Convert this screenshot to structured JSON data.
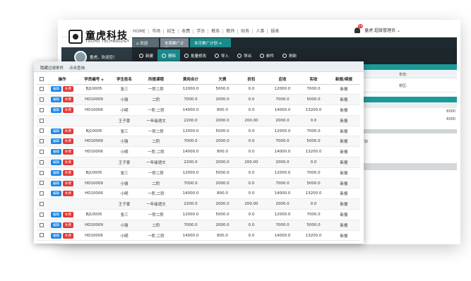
{
  "logo": {
    "cn": "童虎科技",
    "en": "TOOHU TECHNOLOGY"
  },
  "topnav": [
    "HOME",
    "市场",
    "招生",
    "收费",
    "学员",
    "教务",
    "教师",
    "财务",
    "人事",
    "报表"
  ],
  "user": {
    "badge": "10",
    "name": "童虎 超级管理员 ⌄"
  },
  "tabs": [
    "⌂ 欢迎",
    "本周推广计划 ×",
    "本月推广计划 ×"
  ],
  "toolbar": [
    "新建",
    "删除",
    "批量修改",
    "导入",
    "导出",
    "邮件",
    "刷新"
  ],
  "sidebar": {
    "welcome": "童虎，欢迎您！"
  },
  "right_panel": {
    "lbl1": "年份:",
    "lbl2": "校区:",
    "v1": "6000",
    "v2": "6000",
    "lbl3": "折扣"
  },
  "filter": {
    "hide": "隐藏过滤条件",
    "query": "点击查询"
  },
  "table": {
    "headers": [
      "操作",
      "学员编号",
      "学生姓名",
      "所报课程",
      "费用合计",
      "欠费",
      "折扣",
      "应收",
      "实收",
      "新报/续报"
    ],
    "edit_label": "编辑",
    "add_label": "补费",
    "rows": [
      {
        "has_ops": true,
        "id": "BJ10005",
        "name": "张三",
        "course": "一阶二阶",
        "total": "12000.0",
        "owe": "5000.0",
        "disc": "0.0",
        "due": "12000.0",
        "paid": "7000.0",
        "type": "新报"
      },
      {
        "has_ops": true,
        "id": "HD10009",
        "name": "小强",
        "course": "二阶",
        "total": "7000.0",
        "owe": "2000.0",
        "disc": "0.0",
        "due": "7000.0",
        "paid": "5000.0",
        "type": "新报"
      },
      {
        "has_ops": true,
        "id": "HD10006",
        "name": "小明",
        "course": "一阶,二阶",
        "total": "14000.0",
        "owe": "800.0",
        "disc": "0.0",
        "due": "14000.0",
        "paid": "13200.0",
        "type": "新报"
      },
      {
        "has_ops": false,
        "id": "",
        "name": "王子豪",
        "course": "一年级语文",
        "total": "2200.0",
        "owe": "2000.0",
        "disc": "200.00",
        "due": "2000.0",
        "paid": "0.0",
        "type": "新报"
      },
      {
        "has_ops": true,
        "id": "BJ10005",
        "name": "张三",
        "course": "一阶二阶",
        "total": "12000.0",
        "owe": "5000.0",
        "disc": "0.0",
        "due": "12000.0",
        "paid": "7000.0",
        "type": "新报"
      },
      {
        "has_ops": true,
        "id": "HD10009",
        "name": "小强",
        "course": "二阶",
        "total": "7000.0",
        "owe": "2000.0",
        "disc": "0.0",
        "due": "7000.0",
        "paid": "5000.0",
        "type": "新报"
      },
      {
        "has_ops": true,
        "id": "HD10006",
        "name": "小明",
        "course": "一阶,二阶",
        "total": "14000.0",
        "owe": "800.0",
        "disc": "0.0",
        "due": "14000.0",
        "paid": "13200.0",
        "type": "新报"
      },
      {
        "has_ops": true,
        "id": "",
        "name": "王子豪",
        "course": "一年级语文",
        "total": "2200.0",
        "owe": "2000.0",
        "disc": "200.00",
        "due": "2000.0",
        "paid": "0.0",
        "type": "新报"
      },
      {
        "has_ops": true,
        "id": "BJ10005",
        "name": "张三",
        "course": "一阶二阶",
        "total": "12000.0",
        "owe": "5000.0",
        "disc": "0.0",
        "due": "12000.0",
        "paid": "7000.0",
        "type": "新报"
      },
      {
        "has_ops": true,
        "id": "HD10009",
        "name": "小强",
        "course": "二阶",
        "total": "7000.0",
        "owe": "2000.0",
        "disc": "0.0",
        "due": "7000.0",
        "paid": "5000.0",
        "type": "新报"
      },
      {
        "has_ops": true,
        "id": "HD10006",
        "name": "小明",
        "course": "一阶,二阶",
        "total": "14000.0",
        "owe": "800.0",
        "disc": "0.0",
        "due": "14000.0",
        "paid": "13200.0",
        "type": "新报"
      },
      {
        "has_ops": false,
        "id": "",
        "name": "王子豪",
        "course": "一年级语文",
        "total": "2200.0",
        "owe": "2000.0",
        "disc": "200.00",
        "due": "2000.0",
        "paid": "0.0",
        "type": "新报"
      },
      {
        "has_ops": true,
        "id": "BJ10005",
        "name": "张三",
        "course": "一阶二阶",
        "total": "12000.0",
        "owe": "5000.0",
        "disc": "0.0",
        "due": "12000.0",
        "paid": "7000.0",
        "type": "新报"
      },
      {
        "has_ops": true,
        "id": "HD10009",
        "name": "小强",
        "course": "二阶",
        "total": "7000.0",
        "owe": "2000.0",
        "disc": "0.0",
        "due": "7000.0",
        "paid": "5000.0",
        "type": "新报"
      },
      {
        "has_ops": true,
        "id": "HD10006",
        "name": "小明",
        "course": "一阶,二阶",
        "total": "14000.0",
        "owe": "800.0",
        "disc": "0.0",
        "due": "14000.0",
        "paid": "13200.0",
        "type": "新报"
      }
    ]
  }
}
